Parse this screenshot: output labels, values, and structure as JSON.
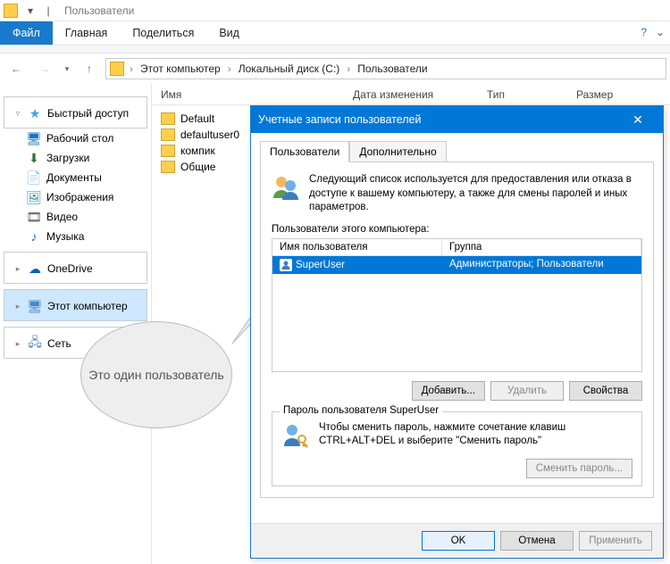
{
  "titlebar": {
    "title": "Пользователи"
  },
  "ribbon": {
    "file": "Файл",
    "home": "Главная",
    "share": "Поделиться",
    "view": "Вид"
  },
  "breadcrumb": {
    "pc": "Этот компьютер",
    "drive": "Локальный диск (C:)",
    "folder": "Пользователи"
  },
  "columns": {
    "name": "Имя",
    "date": "Дата изменения",
    "type": "Тип",
    "size": "Размер"
  },
  "sidebar": {
    "quick": "Быстрый доступ",
    "desktop": "Рабочий стол",
    "downloads": "Загрузки",
    "documents": "Документы",
    "pictures": "Изображения",
    "videos": "Видео",
    "music": "Музыка",
    "onedrive": "OneDrive",
    "thispc": "Этот компьютер",
    "network": "Сеть"
  },
  "folders": [
    {
      "name": "Default"
    },
    {
      "name": "defaultuser0"
    },
    {
      "name": "компик"
    },
    {
      "name": "Общие"
    }
  ],
  "callout": "Это один пользователь",
  "dialog": {
    "title": "Учетные записи пользователей",
    "tab_users": "Пользователи",
    "tab_advanced": "Дополнительно",
    "info": "Следующий список используется для предоставления или отказа в доступе к вашему компьютеру, а также для смены паролей и иных параметров.",
    "list_label": "Пользователи этого компьютера:",
    "col_user": "Имя пользователя",
    "col_group": "Группа",
    "row_user": "SuperUser",
    "row_group": "Администраторы; Пользователи",
    "btn_add": "Добавить...",
    "btn_remove": "Удалить",
    "btn_props": "Свойства",
    "group_label": "Пароль пользователя SuperUser",
    "pwd_info": "Чтобы сменить пароль, нажмите сочетание клавиш CTRL+ALT+DEL и выберите \"Сменить пароль\"",
    "btn_reset": "Сменить пароль...",
    "btn_ok": "OK",
    "btn_cancel": "Отмена",
    "btn_apply": "Применить"
  }
}
